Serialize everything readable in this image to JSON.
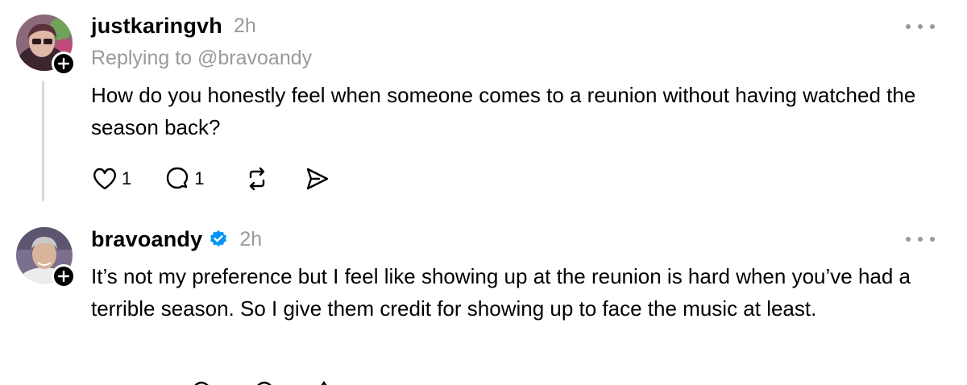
{
  "posts": [
    {
      "username": "justkaringvh",
      "time": "2h",
      "replying_to": "Replying to @bravoandy",
      "text": "How do you honestly feel when someone comes to a reunion without having watched the season back?",
      "likes": "1",
      "replies": "1",
      "avatar_icon": "user-avatar-photo",
      "verified": false
    },
    {
      "username": "bravoandy",
      "time": "2h",
      "text": "It’s not my preference but I feel like showing up at the reunion is hard when you’ve had a terrible season. So I give them credit for showing up to face the music at least.",
      "avatar_icon": "user-avatar-photo",
      "verified": true
    }
  ],
  "colors": {
    "accent_verified": "#0095f6",
    "muted": "#9a9a9a",
    "thread": "#d9d9d9"
  }
}
